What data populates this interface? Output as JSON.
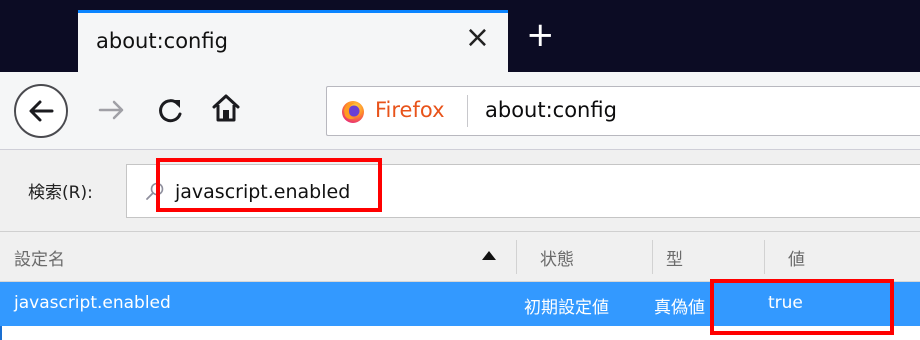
{
  "browser": {
    "tab": {
      "title": "about:config",
      "close_glyph": "×"
    },
    "new_tab_glyph": "+",
    "nav": {
      "back_icon": "back-arrow-icon",
      "forward_icon": "forward-arrow-icon",
      "reload_icon": "reload-icon",
      "home_icon": "home-icon"
    },
    "urlbar": {
      "identity_label": "Firefox",
      "url": "about:config"
    }
  },
  "config": {
    "search": {
      "label": "検索(R):",
      "value": "javascript.enabled"
    },
    "columns": [
      "設定名",
      "状態",
      "型",
      "値"
    ],
    "rows": [
      {
        "name": "javascript.enabled",
        "status": "初期設定値",
        "type": "真偽値",
        "value": "true"
      }
    ]
  },
  "colors": {
    "tabstrip": "#0c0c24",
    "accent": "#0a84ff",
    "selection": "#3399ff",
    "highlight": "#ff0000",
    "firefox_brand": "#e8531a"
  }
}
